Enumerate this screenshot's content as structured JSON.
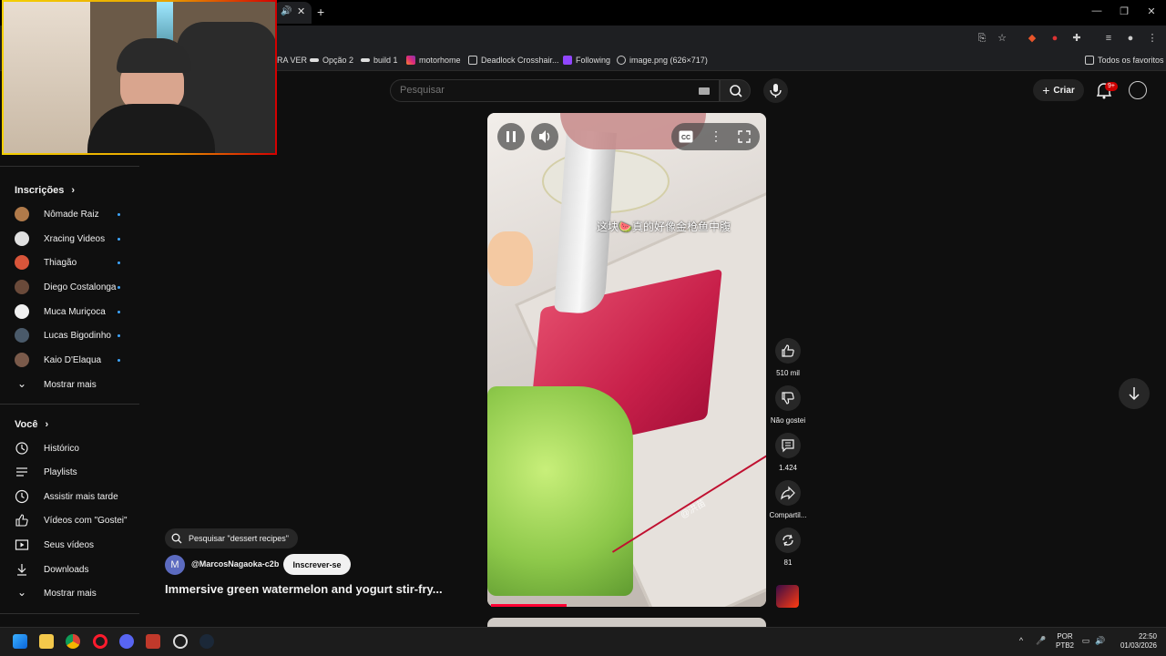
{
  "browser": {
    "tab_partial_title": "",
    "bookmarks": [
      {
        "label": "RA VER"
      },
      {
        "label": "Opção 2"
      },
      {
        "label": "build 1"
      },
      {
        "label": "motorhome"
      },
      {
        "label": "Deadlock Crosshair..."
      },
      {
        "label": "Following"
      },
      {
        "label": "image.png (626×717)"
      }
    ],
    "all_bookmarks_label": "Todos os favoritos"
  },
  "header": {
    "search_placeholder": "Pesquisar",
    "create_label": "Criar",
    "notification_count": "9+"
  },
  "sidebar": {
    "subscriptions_heading": "Inscrições",
    "channels": [
      {
        "name": "Nômade Raiz",
        "color": "#b07a4a"
      },
      {
        "name": "Xracing Videos",
        "color": "#e0e0e0"
      },
      {
        "name": "Thiagão",
        "color": "#d8553a"
      },
      {
        "name": "Diego Costalonga",
        "color": "#6a4a3a"
      },
      {
        "name": "Muca Muriçoca",
        "color": "#f0f0f0"
      },
      {
        "name": "Lucas Bigodinho",
        "color": "#4a5a6a"
      },
      {
        "name": "Kaio D'Elaqua",
        "color": "#7a5a4a"
      }
    ],
    "show_more_1": "Mostrar mais",
    "you_heading": "Você",
    "you_items": [
      {
        "label": "Histórico",
        "icon": "history-icon"
      },
      {
        "label": "Playlists",
        "icon": "playlists-icon"
      },
      {
        "label": "Assistir mais tarde",
        "icon": "watch-later-icon"
      },
      {
        "label": "Vídeos com \"Gostei\"",
        "icon": "liked-videos-icon"
      },
      {
        "label": "Seus vídeos",
        "icon": "your-videos-icon"
      },
      {
        "label": "Downloads",
        "icon": "downloads-icon"
      }
    ],
    "show_more_2": "Mostrar mais"
  },
  "video": {
    "caption": "这块🍉真的好像金枪鱼中腹",
    "watermark": "@洪苗",
    "progress_fraction": 0.28
  },
  "actions": {
    "likes": "510 mil",
    "dislike_label": "Não gostei",
    "comments": "1.424",
    "share_label": "Compartil...",
    "remix_count": "81"
  },
  "info": {
    "search_suggestion": "Pesquisar \"dessert recipes\"",
    "channel_initial": "M",
    "channel_handle": "@MarcosNagaoka-c2b",
    "subscribe_label": "Inscrever-se",
    "video_title": "Immersive green watermelon and yogurt stir-fry..."
  },
  "taskbar": {
    "lang_line1": "POR",
    "lang_line2": "PTB2",
    "time": "22:50",
    "date": "01/03/2026"
  }
}
